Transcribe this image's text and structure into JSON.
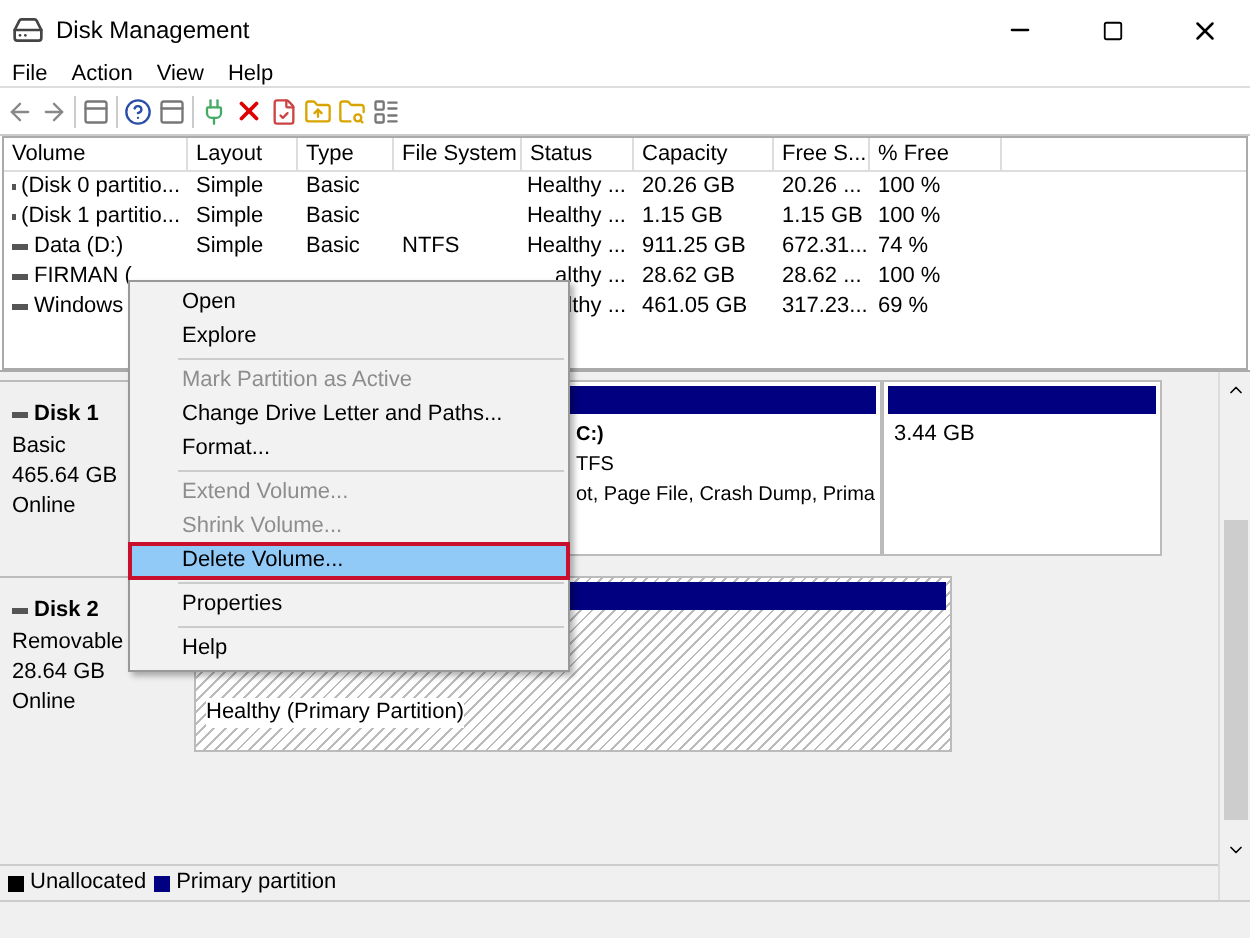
{
  "window": {
    "title": "Disk Management"
  },
  "menu_bar": [
    "File",
    "Action",
    "View",
    "Help"
  ],
  "table": {
    "columns": [
      "Volume",
      "Layout",
      "Type",
      "File System",
      "Status",
      "Capacity",
      "Free S...",
      "% Free"
    ],
    "rows": [
      {
        "cells": [
          "(Disk 0 partitio...",
          "Simple",
          "Basic",
          "",
          "Healthy ...",
          "20.26 GB",
          "20.26 ...",
          "100 %"
        ]
      },
      {
        "cells": [
          "(Disk 1 partitio...",
          "Simple",
          "Basic",
          "",
          "Healthy ...",
          "1.15 GB",
          "1.15 GB",
          "100 %"
        ]
      },
      {
        "cells": [
          "Data (D:)",
          "Simple",
          "Basic",
          "NTFS",
          "Healthy ...",
          "911.25 GB",
          "672.31...",
          "74 %"
        ]
      },
      {
        "cells": [
          "FIRMAN (",
          "",
          "",
          "",
          "althy ...",
          "28.62 GB",
          "28.62 ...",
          "100 %"
        ]
      },
      {
        "cells": [
          "Windows",
          "",
          "",
          "",
          "lthy ...",
          "461.05 GB",
          "317.23...",
          "69 %"
        ]
      }
    ]
  },
  "disks": [
    {
      "name": "Disk 1",
      "lines": [
        "Basic",
        "465.64 GB",
        "Online"
      ],
      "partitions": [
        {
          "lines": [
            "C:)",
            "TFS",
            "ot, Page File, Crash Dump, Prima"
          ],
          "selected": false,
          "covered": true
        },
        {
          "lines": [
            "3.44 GB"
          ],
          "selected": false,
          "covered": false
        }
      ]
    },
    {
      "name": "Disk 2",
      "lines": [
        "Removable",
        "28.64 GB",
        "Online"
      ],
      "partitions": [
        {
          "lines": [
            "Healthy (Primary Partition)"
          ],
          "selected": true,
          "covered": false
        }
      ]
    }
  ],
  "legend": [
    {
      "label": "Unallocated",
      "color": "#000000"
    },
    {
      "label": "Primary partition",
      "color": "#000080"
    }
  ],
  "context_menu": [
    {
      "kind": "item",
      "label": "Open",
      "disabled": false,
      "selected": false
    },
    {
      "kind": "item",
      "label": "Explore",
      "disabled": false,
      "selected": false
    },
    {
      "kind": "separator"
    },
    {
      "kind": "item",
      "label": "Mark Partition as Active",
      "disabled": true,
      "selected": false
    },
    {
      "kind": "item",
      "label": "Change Drive Letter and Paths...",
      "disabled": false,
      "selected": false
    },
    {
      "kind": "item",
      "label": "Format...",
      "disabled": false,
      "selected": false
    },
    {
      "kind": "separator"
    },
    {
      "kind": "item",
      "label": "Extend Volume...",
      "disabled": true,
      "selected": false
    },
    {
      "kind": "item",
      "label": "Shrink Volume...",
      "disabled": true,
      "selected": false
    },
    {
      "kind": "item",
      "label": "Delete Volume...",
      "disabled": false,
      "selected": true
    },
    {
      "kind": "separator"
    },
    {
      "kind": "item",
      "label": "Properties",
      "disabled": false,
      "selected": false
    },
    {
      "kind": "separator"
    },
    {
      "kind": "item",
      "label": "Help",
      "disabled": false,
      "selected": false
    }
  ]
}
